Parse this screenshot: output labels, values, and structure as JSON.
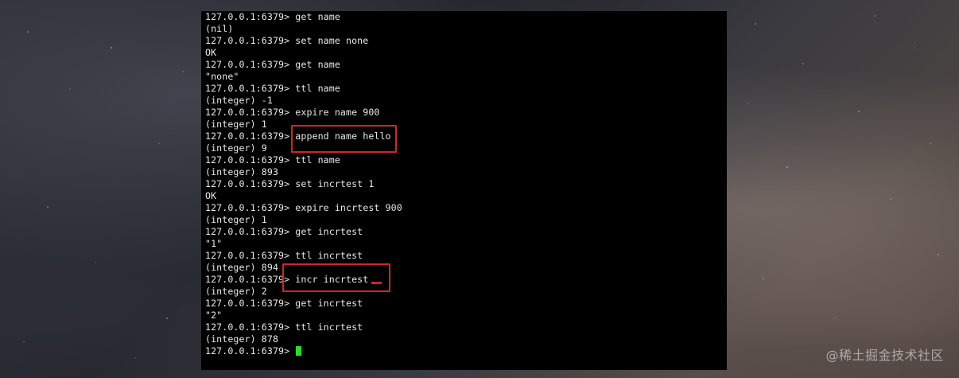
{
  "terminal": {
    "lines": [
      "127.0.0.1:6379> get name",
      "(nil)",
      "127.0.0.1:6379> set name none",
      "OK",
      "127.0.0.1:6379> get name",
      "\"none\"",
      "127.0.0.1:6379> ttl name",
      "(integer) -1",
      "127.0.0.1:6379> expire name 900",
      "(integer) 1",
      "127.0.0.1:6379> append name hello",
      "(integer) 9",
      "127.0.0.1:6379> ttl name",
      "(integer) 893",
      "127.0.0.1:6379> set incrtest 1",
      "OK",
      "127.0.0.1:6379> expire incrtest 900",
      "(integer) 1",
      "127.0.0.1:6379> get incrtest",
      "\"1\"",
      "127.0.0.1:6379> ttl incrtest",
      "(integer) 894",
      "127.0.0.1:6379> incr incrtest",
      "(integer) 2",
      "127.0.0.1:6379> get incrtest",
      "\"2\"",
      "127.0.0.1:6379> ttl incrtest",
      "(integer) 878"
    ],
    "prompt": "127.0.0.1:6379> ",
    "colors": {
      "background": "#000000",
      "text": "#e8e8e8",
      "cursor": "#22e022",
      "highlight": "#d0252b"
    }
  },
  "watermark": "@稀土掘金技术社区"
}
